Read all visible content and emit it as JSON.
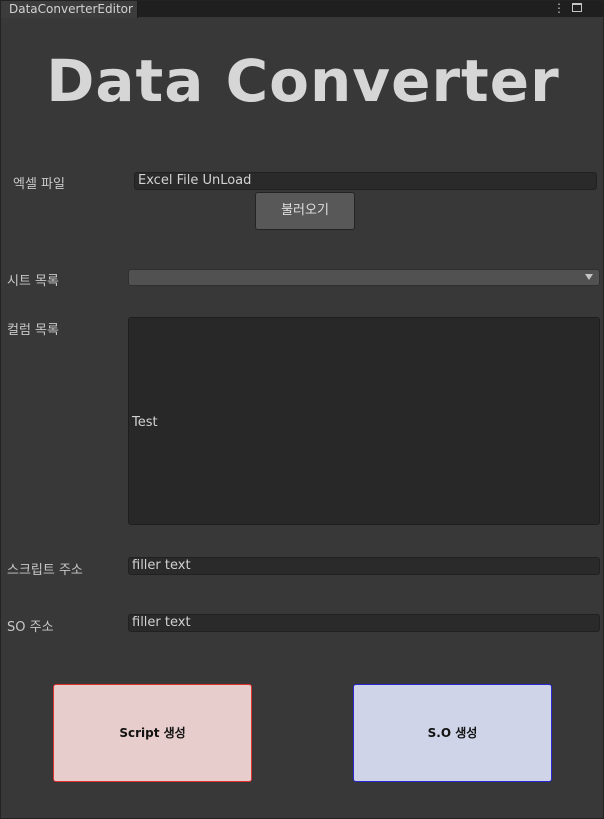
{
  "window": {
    "tab_title": "DataConverterEditor",
    "menu_icon": "kebab-menu-icon",
    "maximize_icon": "maximize-icon",
    "close_glyph": "✕",
    "kebab_glyph": "⋮"
  },
  "header": {
    "title": "Data Converter"
  },
  "excel": {
    "label": "엑셀 파일",
    "path_value": "Excel File UnLoad",
    "load_button": "불러오기"
  },
  "sheet": {
    "label": "시트 목록",
    "selected": ""
  },
  "columns": {
    "label": "컬럼 목록",
    "items": [
      "Test"
    ]
  },
  "script_path": {
    "label": "스크립트 주소",
    "value": "filler text"
  },
  "so_path": {
    "label": "SO 주소",
    "value": "filler text"
  },
  "actions": {
    "script_button": "Script 생성",
    "so_button": "S.O 생성"
  },
  "colors": {
    "script_button_bg": "#e8cdcd",
    "script_button_border": "#e03030",
    "so_button_bg": "#d0d4e8",
    "so_button_border": "#2828d0"
  }
}
